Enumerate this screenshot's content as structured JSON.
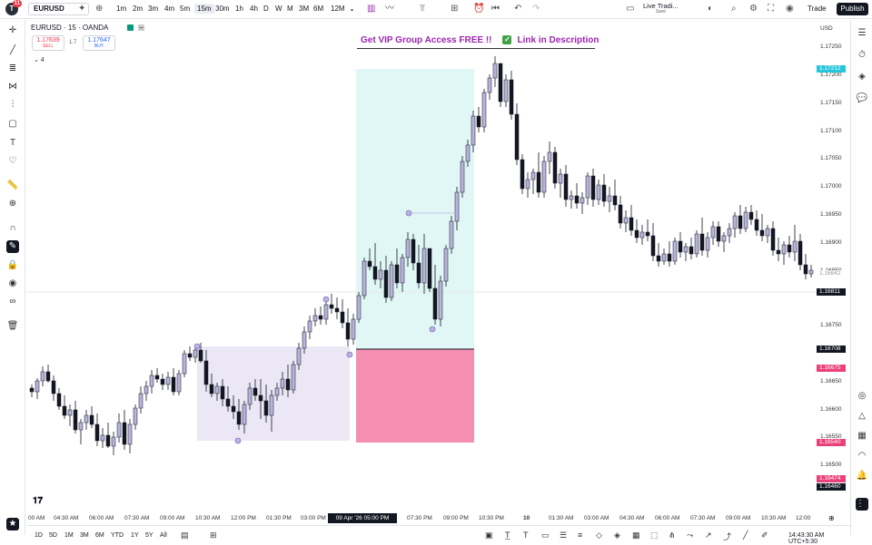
{
  "topbar": {
    "notification_count": "11",
    "symbol": "EURUSD",
    "intervals": [
      "1m",
      "2m",
      "3m",
      "4m",
      "5m",
      "15m",
      "30m",
      "1h",
      "4h",
      "D",
      "W",
      "M",
      "3M",
      "6M",
      "12M"
    ],
    "active_interval": "15m",
    "live_trading_label": "Live Tradi...",
    "live_trading_sub": "Save",
    "trade_label": "Trade",
    "publish_label": "Publish"
  },
  "legend": {
    "title": "EURUSD · 15 · OANDA",
    "sell_price": "1.17639",
    "sell_label": "SELL",
    "spread": "1.7",
    "buy_price": "1.17647",
    "buy_label": "BUY",
    "indicator_count": "4"
  },
  "promo": {
    "text_left": "Get VIP Group Access FREE  !!",
    "text_right": "Link in Description"
  },
  "price_scale": {
    "currency": "USD",
    "ticks": [
      "1.17250",
      "1.17200",
      "1.17150",
      "1.17100",
      "1.17050",
      "1.17000",
      "1.16950",
      "1.16900",
      "1.16850",
      "1.16800",
      "1.16750",
      "1.16700",
      "1.16650",
      "1.16600",
      "1.16550",
      "1.16500",
      "1.16450"
    ],
    "labels": {
      "current_price": "1.17212",
      "cross_price": "1.16842",
      "crosshair": "1.16811",
      "entry_price": "1.16708",
      "stop_price": "1.16675",
      "stop_price_2": "1.16540",
      "target_low": "1.16474",
      "target_low_2": "1.16460"
    }
  },
  "time_scale": {
    "ticks": [
      "00 AM",
      "04:30 AM",
      "06:00 AM",
      "07:30 AM",
      "09:00 AM",
      "10:30 AM",
      "12:00 PM",
      "01:30 PM",
      "03:00 PM",
      "07:30 PM",
      "09:00 PM",
      "10:30 PM",
      "10",
      "01:30 AM",
      "03:00 AM",
      "04:30 AM",
      "06:00 AM",
      "07:30 AM",
      "09:00 AM",
      "10:30 AM",
      "12:00"
    ],
    "cursor_label": "09 Apr '26   05:00 PM"
  },
  "bottom_bar": {
    "ranges": [
      "1D",
      "5D",
      "1M",
      "3M",
      "6M",
      "YTD",
      "1Y",
      "5Y",
      "All"
    ],
    "clock": "14:43:30 AM UTC+5:30"
  },
  "colors": {
    "bull_candle": "#b9b4dc",
    "bear_candle": "#131722",
    "target_zone": "#e0f7f5",
    "stop_zone": "#f48fb1",
    "range_zone": "#ebe7f5",
    "accent": "#9c27b0"
  }
}
